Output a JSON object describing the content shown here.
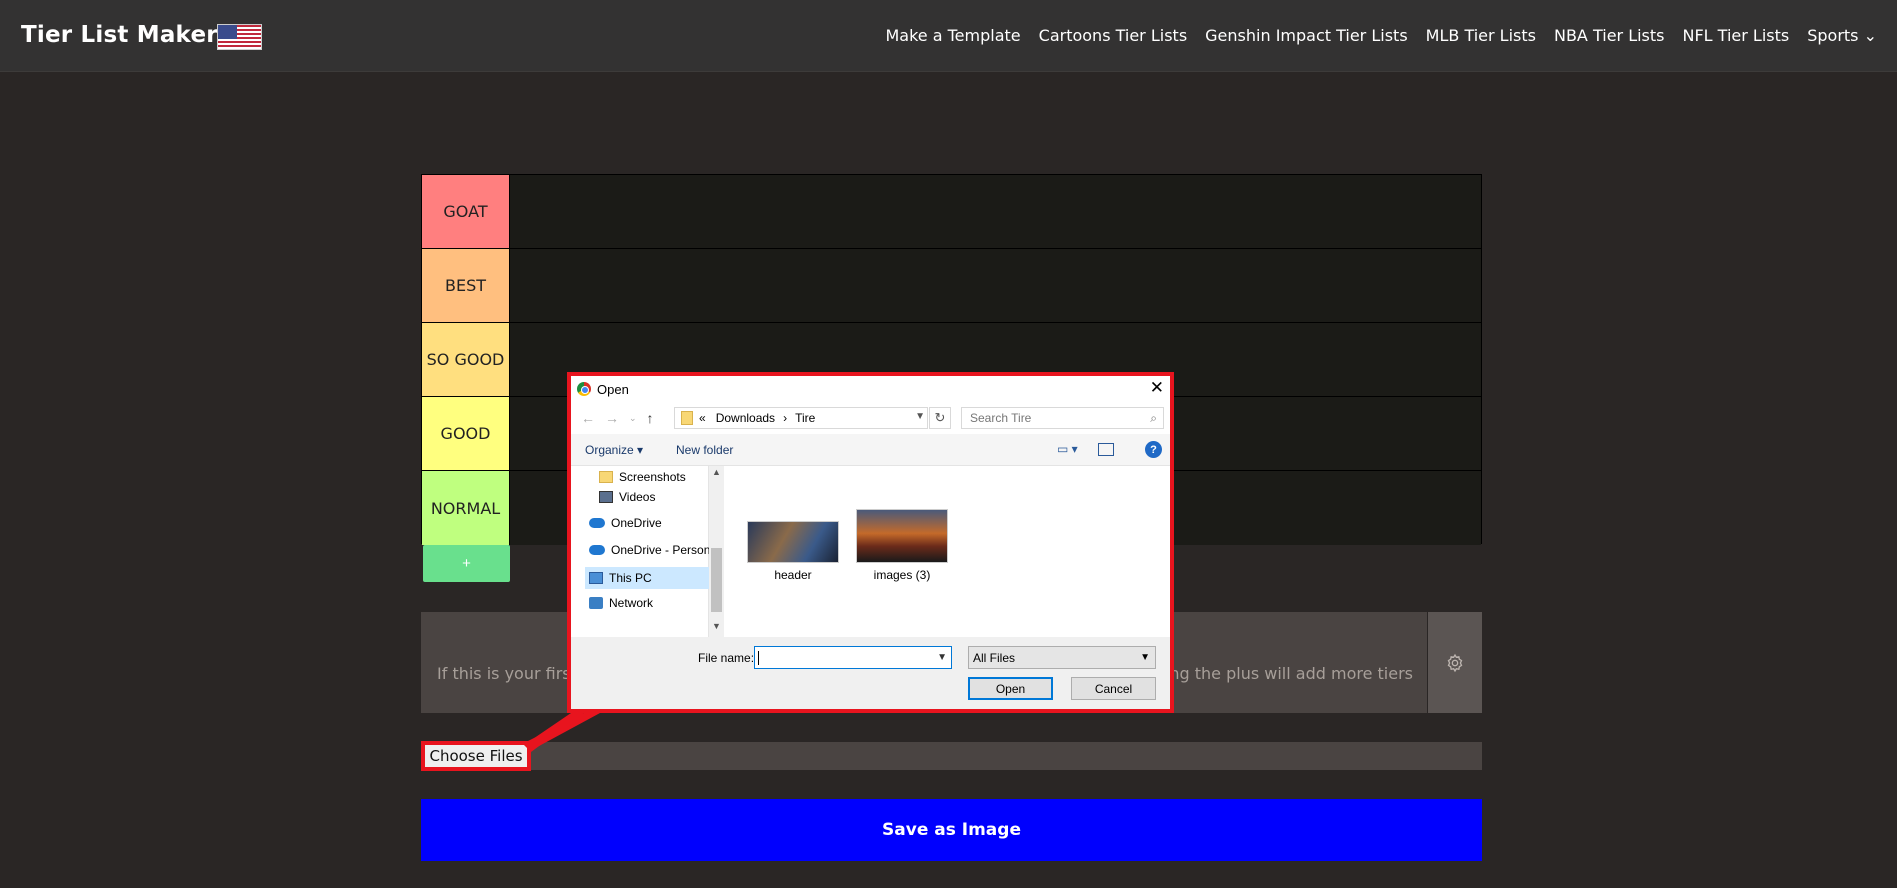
{
  "header": {
    "brand": "Tier List Maker",
    "nav": [
      "Make a Template",
      "Cartoons Tier Lists",
      "Genshin Impact Tier Lists",
      "MLB Tier Lists",
      "NBA Tier Lists",
      "NFL Tier Lists",
      "Sports ⌄"
    ]
  },
  "tiers": [
    {
      "label": "GOAT",
      "color": "#ff7f7f"
    },
    {
      "label": "BEST",
      "color": "#ffbf7f"
    },
    {
      "label": "SO GOOD",
      "color": "#ffdf7f"
    },
    {
      "label": "GOOD",
      "color": "#ffff7f"
    },
    {
      "label": "NORMAL",
      "color": "#bfff7f"
    }
  ],
  "add_tier_label": "+",
  "info": {
    "left_text": "If this is your first",
    "right_text": "ing the plus will add more tiers"
  },
  "choose_files_label": "Choose Files",
  "save_label": "Save as Image",
  "dialog": {
    "title": "Open",
    "close": "✕",
    "path_prefix": "«",
    "path": [
      "Downloads",
      "Tire"
    ],
    "path_sep": "›",
    "search_placeholder": "Search Tire",
    "organize": "Organize ▾",
    "new_folder": "New folder",
    "help": "?",
    "nav_items": [
      "Screenshots",
      "Videos",
      "OneDrive",
      "OneDrive - Person",
      "This PC",
      "Network"
    ],
    "files": [
      "header",
      "images (3)"
    ],
    "file_name_label": "File name:",
    "file_name_value": "",
    "filter_value": "All Files",
    "open_label": "Open",
    "cancel_label": "Cancel"
  }
}
